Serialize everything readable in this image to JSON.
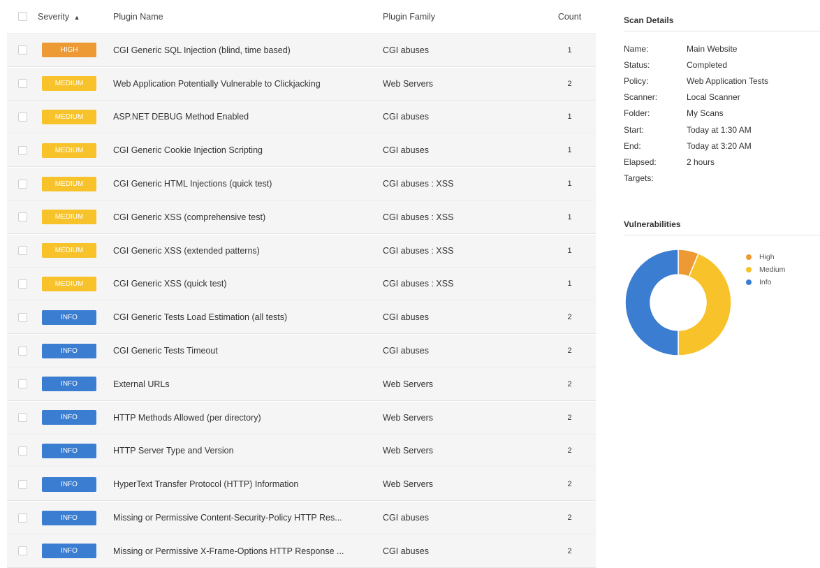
{
  "colors": {
    "high": "#EE9A34",
    "medium": "#F7C22A",
    "info": "#3B7DD1"
  },
  "table": {
    "headers": {
      "severity": "Severity",
      "sort_icon": "caret-up-icon",
      "plugin_name": "Plugin Name",
      "plugin_family": "Plugin Family",
      "count": "Count"
    },
    "rows": [
      {
        "severity": "HIGH",
        "level": "high",
        "name": "CGI Generic SQL Injection (blind, time based)",
        "family": "CGI abuses",
        "count": "1"
      },
      {
        "severity": "MEDIUM",
        "level": "medium",
        "name": "Web Application Potentially Vulnerable to Clickjacking",
        "family": "Web Servers",
        "count": "2"
      },
      {
        "severity": "MEDIUM",
        "level": "medium",
        "name": "ASP.NET DEBUG Method Enabled",
        "family": "CGI abuses",
        "count": "1"
      },
      {
        "severity": "MEDIUM",
        "level": "medium",
        "name": "CGI Generic Cookie Injection Scripting",
        "family": "CGI abuses",
        "count": "1"
      },
      {
        "severity": "MEDIUM",
        "level": "medium",
        "name": "CGI Generic HTML Injections (quick test)",
        "family": "CGI abuses : XSS",
        "count": "1"
      },
      {
        "severity": "MEDIUM",
        "level": "medium",
        "name": "CGI Generic XSS (comprehensive test)",
        "family": "CGI abuses : XSS",
        "count": "1"
      },
      {
        "severity": "MEDIUM",
        "level": "medium",
        "name": "CGI Generic XSS (extended patterns)",
        "family": "CGI abuses : XSS",
        "count": "1"
      },
      {
        "severity": "MEDIUM",
        "level": "medium",
        "name": "CGI Generic XSS (quick test)",
        "family": "CGI abuses : XSS",
        "count": "1"
      },
      {
        "severity": "INFO",
        "level": "info",
        "name": "CGI Generic Tests Load Estimation (all tests)",
        "family": "CGI abuses",
        "count": "2"
      },
      {
        "severity": "INFO",
        "level": "info",
        "name": "CGI Generic Tests Timeout",
        "family": "CGI abuses",
        "count": "2"
      },
      {
        "severity": "INFO",
        "level": "info",
        "name": "External URLs",
        "family": "Web Servers",
        "count": "2"
      },
      {
        "severity": "INFO",
        "level": "info",
        "name": "HTTP Methods Allowed (per directory)",
        "family": "Web Servers",
        "count": "2"
      },
      {
        "severity": "INFO",
        "level": "info",
        "name": "HTTP Server Type and Version",
        "family": "Web Servers",
        "count": "2"
      },
      {
        "severity": "INFO",
        "level": "info",
        "name": "HyperText Transfer Protocol (HTTP) Information",
        "family": "Web Servers",
        "count": "2"
      },
      {
        "severity": "INFO",
        "level": "info",
        "name": "Missing or Permissive Content-Security-Policy HTTP Res...",
        "family": "CGI abuses",
        "count": "2"
      },
      {
        "severity": "INFO",
        "level": "info",
        "name": "Missing or Permissive X-Frame-Options HTTP Response ...",
        "family": "CGI abuses",
        "count": "2"
      }
    ]
  },
  "scan_details": {
    "title": "Scan Details",
    "items": [
      {
        "label": "Name:",
        "value": "Main Website"
      },
      {
        "label": "Status:",
        "value": "Completed"
      },
      {
        "label": "Policy:",
        "value": "Web Application Tests"
      },
      {
        "label": "Scanner:",
        "value": "Local Scanner"
      },
      {
        "label": "Folder:",
        "value": "My Scans"
      },
      {
        "label": "Start:",
        "value": "Today at 1:30 AM"
      },
      {
        "label": "End:",
        "value": "Today at 3:20 AM"
      },
      {
        "label": "Elapsed:",
        "value": "2 hours"
      },
      {
        "label": "Targets:",
        "value": ""
      }
    ]
  },
  "vulnerabilities": {
    "title": "Vulnerabilities",
    "legend": [
      {
        "label": "High",
        "level": "high"
      },
      {
        "label": "Medium",
        "level": "medium"
      },
      {
        "label": "Info",
        "level": "info"
      }
    ]
  },
  "chart_data": {
    "type": "pie",
    "title": "Vulnerabilities",
    "categories": [
      "High",
      "Medium",
      "Info"
    ],
    "values": [
      1,
      7,
      8
    ],
    "colors": [
      "#EE9A34",
      "#F7C22A",
      "#3B7DD1"
    ],
    "legend": "right"
  }
}
